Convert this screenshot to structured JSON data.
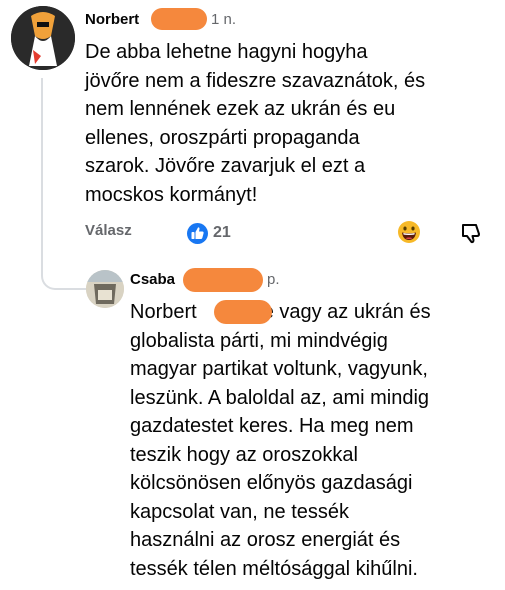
{
  "comment": {
    "author": "Norbert",
    "time": "1 n.",
    "lines": [
      "De abba lehetne hagyni hogyha",
      "jövőre nem a fideszre szavaznátok, és",
      "nem lennének ezek az ukrán és eu",
      "ellenes, oroszpárti propaganda",
      "szarok. Jövőre zavarjuk el ezt a",
      "mocskos kormányt!"
    ],
    "reply_label": "Válasz",
    "like_count": "21"
  },
  "reply": {
    "author": "Csaba",
    "time": "p.",
    "mention": "Norbert",
    "lines": [
      "Te vagy az ukrán és",
      "globalista párti, mi mindvégig",
      "magyar partikat voltunk, vagyunk,",
      "leszünk. A baloldal az, ami mindig",
      "gazdatestet keres. Ha meg nem",
      "teszik hogy az oroszokkal",
      "kölcsönösen előnyös gazdasági",
      "kapcsolat van, ne tessék",
      "használni az orosz energiát és",
      "tessék télen méltósággal kihűlni."
    ]
  },
  "icons": {
    "like": "thumbs-up-icon",
    "reaction": "grinning-face-icon",
    "dislike": "thumbs-down-icon"
  },
  "colors": {
    "like_blue": "#1877f2",
    "redaction": "#f5883d",
    "secondary_text": "#65676b"
  }
}
